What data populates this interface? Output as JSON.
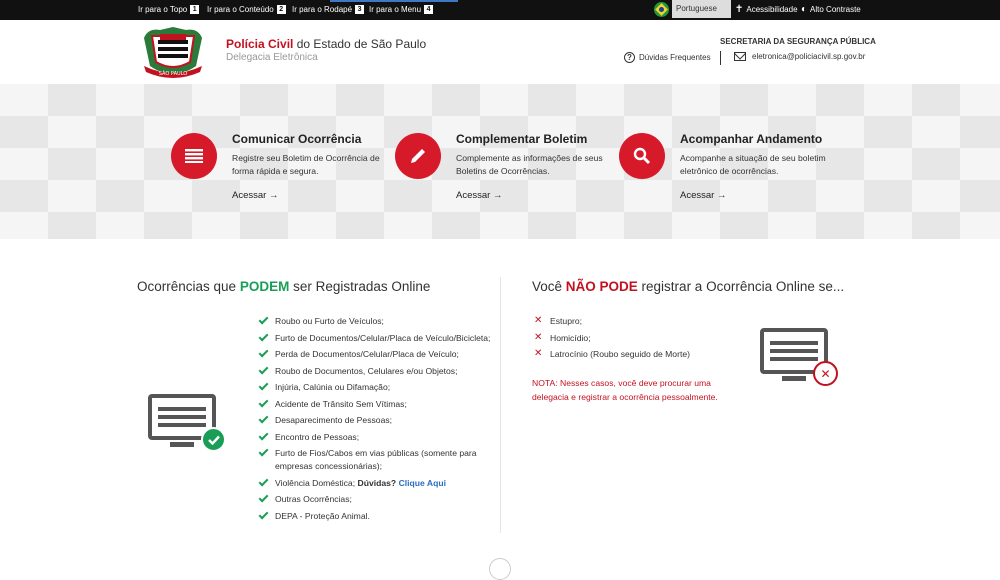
{
  "topbar": {
    "skip_links": [
      {
        "label": "Ir para o Topo",
        "key": "1"
      },
      {
        "label": "Ir para o Conteúdo",
        "key": "2"
      },
      {
        "label": "Ir para o Rodapé",
        "key": "3"
      },
      {
        "label": "Ir para o Menu",
        "key": "4"
      }
    ],
    "language": "Portuguese",
    "accessibility_label": "Acessibilidade",
    "contrast_label": "Alto Contraste"
  },
  "header": {
    "title_red": "Polícia Civil",
    "title_rest": " do Estado de São Paulo",
    "subtitle": "Delegacia Eletrônica",
    "secretaria": "SECRETARIA DA SEGURANÇA PÚBLICA",
    "faq_label": "Dúvidas Frequentes",
    "email": "eletronica@policiacivil.sp.gov.br"
  },
  "cards": [
    {
      "title": "Comunicar Ocorrência",
      "desc": "Registre seu Boletim de Ocorrência de forma rápida e segura.",
      "link": "Acessar",
      "icon": "list-icon"
    },
    {
      "title": "Complementar Boletim",
      "desc": "Complemente as informações de seus Boletins de Ocorrências.",
      "link": "Acessar",
      "icon": "pencil-icon"
    },
    {
      "title": "Acompanhar Andamento",
      "desc": "Acompanhe a situação de seu boletim eletrônico de ocorrências.",
      "link": "Acessar",
      "icon": "search-icon"
    }
  ],
  "can_register": {
    "title_pre": "Ocorrências que ",
    "title_em": "PODEM",
    "title_post": " ser Registradas Online",
    "items": [
      "Roubo ou Furto de Veículos;",
      "Furto de Documentos/Celular/Placa de Veículo/Bicicleta;",
      "Perda de Documentos/Celular/Placa de Veículo;",
      "Roubo de Documentos, Celulares e/ou Objetos;",
      "Injúria, Calúnia ou Difamação;",
      "Acidente de Trânsito Sem Vítimas;",
      "Desaparecimento de Pessoas;",
      "Encontro de Pessoas;",
      "Furto de Fios/Cabos em vias públicas (somente para empresas concessionárias);"
    ],
    "violencia_text": "Violência Doméstica; ",
    "duvidas_label": "Dúvidas?",
    "clique_label": "Clique Aqui",
    "items_after": [
      "Outras Ocorrências;",
      "DEPA - Proteção Animal."
    ]
  },
  "cannot_register": {
    "title_pre": "Você ",
    "title_em": "NÃO PODE",
    "title_post": " registrar a Ocorrência Online se...",
    "items": [
      "Estupro;",
      "Homicídio;",
      "Latrocínio (Roubo seguido de Morte)"
    ],
    "note": "NOTA: Nesses casos, você deve procurar uma delegacia e registrar a ocorrência pessoalmente."
  },
  "colors": {
    "red": "#d61a2a",
    "green": "#1a9e57",
    "link_blue": "#2d6dbf"
  }
}
